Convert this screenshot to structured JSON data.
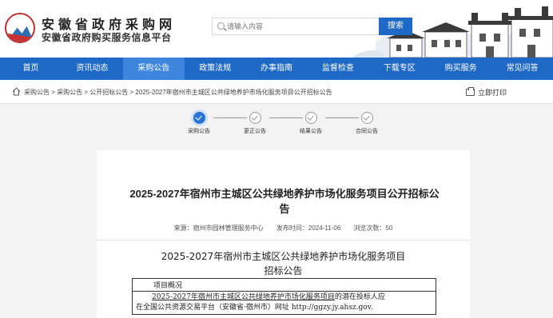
{
  "header": {
    "site_title": "安徽省政府采购网",
    "site_subtitle": "安徽省政府购买服务信息平台",
    "search_placeholder": "请输入内容",
    "search_button": "搜索"
  },
  "nav": {
    "items": [
      "首页",
      "资讯动态",
      "采购公告",
      "政策法规",
      "办事指南",
      "监督检查",
      "下载专区",
      "购买服务",
      "常见问答"
    ],
    "active_index": 2
  },
  "breadcrumb": {
    "items": [
      "采购公告",
      "采购公告",
      "公开招标公告",
      "2025-2027年宿州市主城区公共绿地养护市场化服务项目公开招标公告"
    ],
    "separator": ">",
    "print_label": "立即打印"
  },
  "steps": {
    "items": [
      "采购公告",
      "更正公告",
      "结果公告",
      "合同公告"
    ],
    "active_index": 0
  },
  "article": {
    "title": "2025-2027年宿州市主城区公共绿地养护市场化服务项目公开招标公告",
    "source": "来源：宿州市园林管理服务中心",
    "publish_time": "发布时间：2024-11-06",
    "views": "浏览次数：50",
    "subtitle_line1": "2025-2027年宿州市主城区公共绿地养护市场化服务项目",
    "subtitle_line2": "招标公告",
    "section_head": "项目概况",
    "para_line1_a": "2025-2027年宿州市主城区公共绿地养护市场化服务项目",
    "para_line1_b": "的潜在投标人应",
    "para_line2": "在全国公共资源交易平台（安徽省·宿州市）网址 http://ggzy.jy.ahsz.gov."
  },
  "colors": {
    "brand_blue": "#1f69c6",
    "nav_active": "#3d86dd",
    "step_active": "#2a73d4"
  }
}
